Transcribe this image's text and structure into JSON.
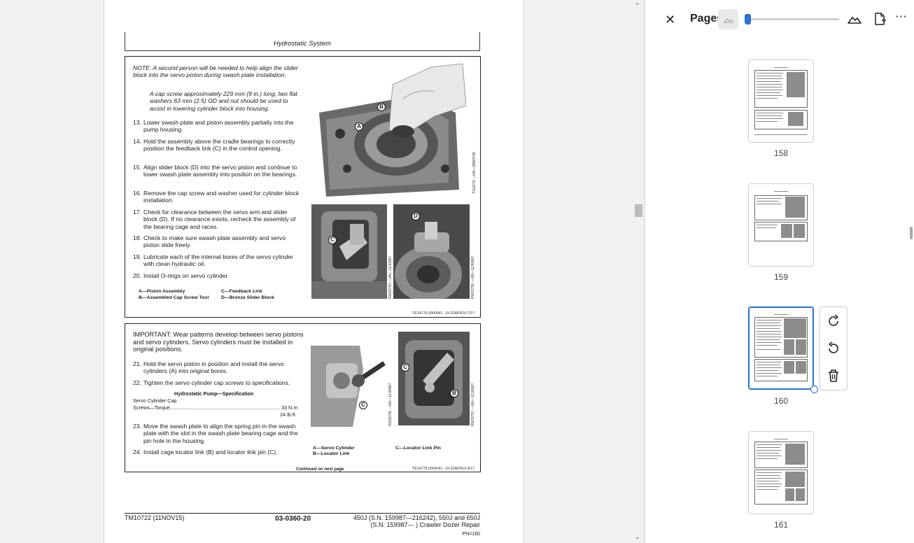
{
  "document": {
    "header_title": "Hydrostatic System",
    "note_text": "NOTE: A second person will be needed to help align the slider block into the servo piston during swash plate installation.",
    "note_text2": "A cap screw approximately 229 mm (9 in.) long, two flat washers 63 mm (2.5) OD and nut should be used to assist in lowering cylinder block into housing.",
    "steps_top": [
      {
        "n": "13.",
        "t": "Lower swash plate and piston assembly partially into the pump housing."
      },
      {
        "n": "14.",
        "t": "Hold the assembly above the cradle bearings to correctly position the feedback link (C) in the control opening."
      },
      {
        "n": "15.",
        "t": "Align slider block (D) into the servo piston and continue to lower swash plate assembly into position on the bearings."
      },
      {
        "n": "16.",
        "t": "Remove the cap screw and washer used for cylinder block installation."
      },
      {
        "n": "17.",
        "t": "Check for clearance between the servo arm and slider block (D). If no clearance exists, recheck the assembly of the bearing cage and races."
      },
      {
        "n": "18.",
        "t": "Check to make sure swash plate assembly and servo piston slide freely."
      },
      {
        "n": "19.",
        "t": "Lubricate each of the internal bores of the servo cylinder with clean hydraulic oil."
      },
      {
        "n": "20.",
        "t": "Install O-rings on servo cylinder."
      }
    ],
    "legend_top": [
      "A—Piston Assembly",
      "B—Assembled Cap Screw Tool",
      "C—Feedback Link",
      "D—Bronze Slider Block"
    ],
    "ref_top": "TE14776,0000041 -19-22APR10-7/17",
    "vref_photo1": "T116276 —UN—28NOV98",
    "vref_photo2": "RW25754 —UN—12JUN97",
    "vref_photo3": "RW25755 —UN—12JUN97",
    "important_text": "IMPORTANT: Wear patterns develop between servo pistons and servo cylinders. Servo cylinders must be installed in original positions.",
    "steps_bottom": [
      {
        "n": "21.",
        "t": "Hold the servo piston in position and install the servo cylinders (A) into original bores."
      },
      {
        "n": "22.",
        "t": "Tighten the servo cylinder cap screws to specifications."
      },
      {
        "n": "23.",
        "t": "Move the swash plate to align the spring pin in the swash plate with the slot in the swash plate bearing cage and the pin hole in the housing."
      },
      {
        "n": "24.",
        "t": "Install cage locator link (B) and locator link pin (C)."
      }
    ],
    "spec_title": "Hydrostatic Pump—Specification",
    "spec_item_1": "Servo Cylinder Cap",
    "spec_item_2": "Screws—Torque",
    "spec_value_1": "33 N·m",
    "spec_value_2": "24 lb-ft",
    "legend_bottom": [
      "A—Servo Cylinder",
      "B—Locator Link",
      "C—Locator Link Pin"
    ],
    "continued": "Continued on next page",
    "ref_bottom": "TE14776,0000041 -19-22APR10-8/17",
    "vref_photo4": "RW25756 —UN—12JUN97",
    "vref_photo5": "RW25757 —UN—12JUN97",
    "footer_left": "TM10722 (11NOV15)",
    "footer_center": "03-0360-20",
    "footer_right_1": "450J (S.N. 159987—216242), 550J and 650J",
    "footer_right_2": "(S.N. 159987— ) Crawler Dozer Repair",
    "footer_pn": "PN=160",
    "callouts": [
      "A",
      "B",
      "C",
      "D",
      "C",
      "A",
      "C",
      "B"
    ]
  },
  "panel": {
    "title": "Pages",
    "close_icon": "close-icon",
    "zoom_level": 0.02,
    "more_label": "⋯",
    "thumbnails": [
      {
        "label": "158",
        "selected": false
      },
      {
        "label": "159",
        "selected": false
      },
      {
        "label": "160",
        "selected": true
      },
      {
        "label": "161",
        "selected": false
      }
    ],
    "page_tools": [
      "rotate-clockwise-icon",
      "rotate-counterclockwise-icon",
      "delete-icon"
    ]
  },
  "colors": {
    "accent": "#2a6fdb",
    "panel_bg": "#ffffff",
    "viewer_bg": "#f1f1f1"
  }
}
